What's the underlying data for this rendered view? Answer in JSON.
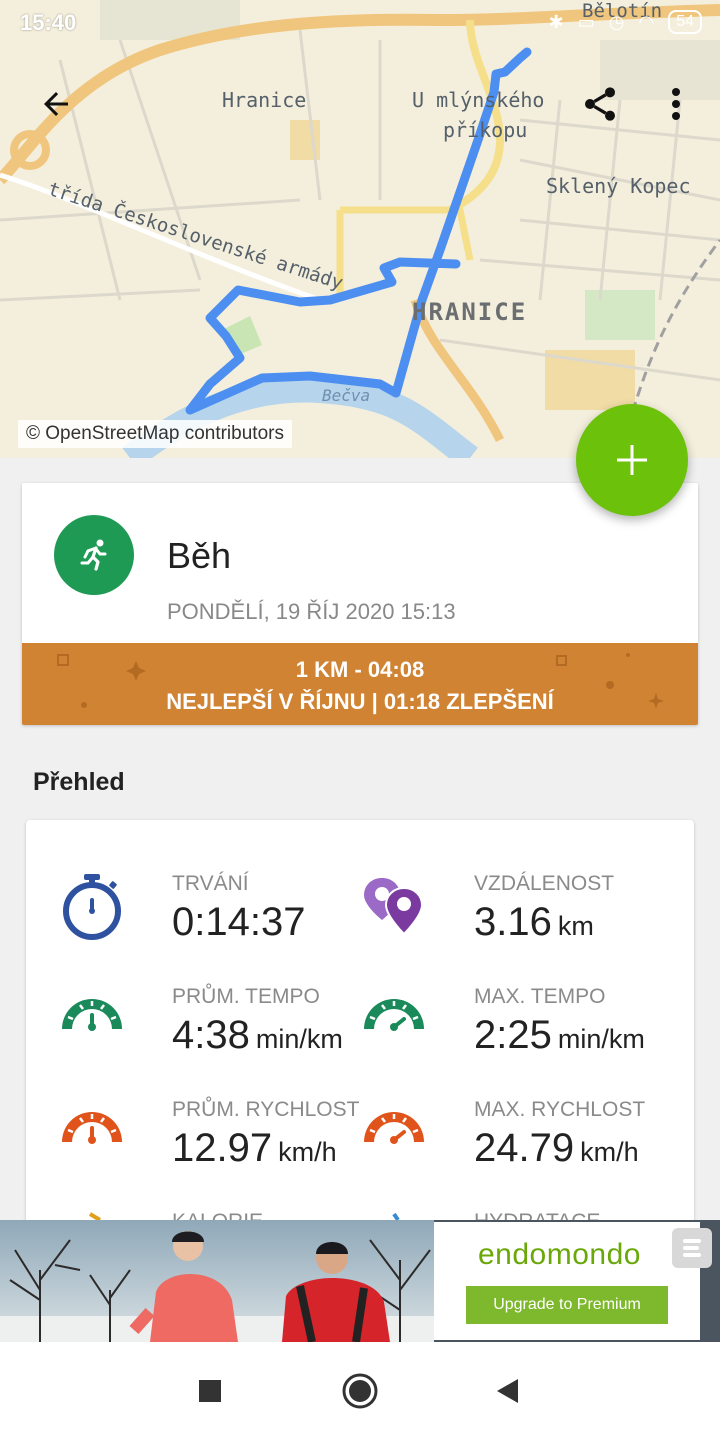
{
  "status_bar": {
    "time": "15:40",
    "battery": "54"
  },
  "map": {
    "labels": {
      "hranice_area": "Hranice",
      "mlynskeho_1": "U mlýnského",
      "mlynskeho_2": "příkopu",
      "skleny_kopec": "Sklený Kopec",
      "street": "třída Československé armády",
      "town": "HRANICE",
      "river": "Bečva",
      "belotin": "Bělotín"
    },
    "credit": "© OpenStreetMap contributors",
    "route_color": "#4d8ff0"
  },
  "toolbar": {
    "back_icon": "arrow-back-icon",
    "share_icon": "share-icon",
    "menu_icon": "more-vert-icon"
  },
  "fab": {
    "icon": "plus-icon",
    "color": "#6cc20a"
  },
  "workout": {
    "sport": "Běh",
    "date": "PONDĚLÍ, 19 ŘÍJ 2020 15:13",
    "icon": "running-icon",
    "icon_color": "#1f9a55",
    "record": {
      "line1": "1 KM  -  04:08",
      "line2": "NEJLEPŠÍ V ŘÍJNU  |  01:18 ZLEPŠENÍ",
      "color": "#d08332"
    }
  },
  "overview": {
    "title": "Přehled",
    "stats": [
      {
        "label": "TRVÁNÍ",
        "value": "0:14:37",
        "unit": "",
        "icon": "stopwatch-icon"
      },
      {
        "label": "VZDÁLENOST",
        "value": "3.16",
        "unit": "km",
        "icon": "location-pins-icon"
      },
      {
        "label": "PRŮM. TEMPO",
        "value": "4:38",
        "unit": "min/km",
        "icon": "pace-gauge-icon"
      },
      {
        "label": "MAX. TEMPO",
        "value": "2:25",
        "unit": "min/km",
        "icon": "pace-gauge-icon"
      },
      {
        "label": "PRŮM. RYCHLOST",
        "value": "12.97",
        "unit": "km/h",
        "icon": "speed-gauge-icon"
      },
      {
        "label": "MAX. RYCHLOST",
        "value": "24.79",
        "unit": "km/h",
        "icon": "speed-gauge-icon"
      },
      {
        "label": "KALORIE",
        "value": "",
        "unit": "",
        "icon": "calories-icon"
      },
      {
        "label": "HYDRATACE",
        "value": "",
        "unit": "",
        "icon": "hydration-icon"
      }
    ]
  },
  "ad": {
    "brand": "endomondo",
    "button": "Upgrade to Premium"
  },
  "nav": {
    "recents": "square-icon",
    "home": "circle-icon",
    "back": "triangle-back-icon"
  }
}
